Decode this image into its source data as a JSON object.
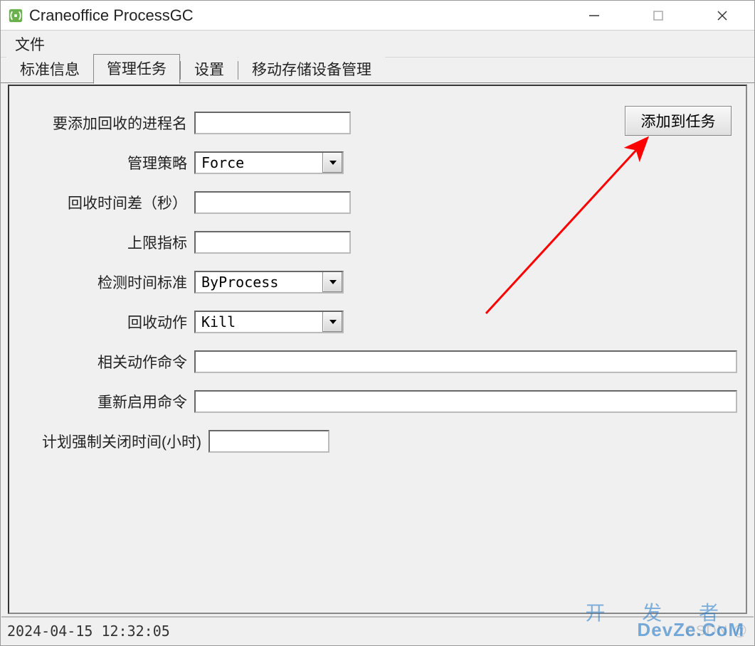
{
  "window": {
    "title": "Craneoffice ProcessGC"
  },
  "menubar": {
    "file": "文件"
  },
  "tabs": {
    "standard_info": "标准信息",
    "manage_tasks": "管理任务",
    "settings": "设置",
    "mobile_storage": "移动存储设备管理",
    "active_index": 1
  },
  "form": {
    "proc_name_label": "要添加回收的进程名",
    "proc_name_value": "",
    "strategy_label": "管理策略",
    "strategy_value": "Force",
    "interval_label": "回收时间差（秒）",
    "interval_value": "",
    "upper_limit_label": "上限指标",
    "upper_limit_value": "",
    "detect_std_label": "检测时间标准",
    "detect_std_value": "ByProcess",
    "action_label": "回收动作",
    "action_value": "Kill",
    "related_cmd_label": "相关动作命令",
    "related_cmd_value": "",
    "reenable_cmd_label": "重新启用命令",
    "reenable_cmd_value": "",
    "force_close_label": "计划强制关闭时间(小时)",
    "force_close_value": "",
    "add_button": "添加到任务"
  },
  "statusbar": {
    "datetime": "2024-04-15 12:32:05",
    "csdn_watermark": "CSDN @"
  },
  "watermark": {
    "line1": "开 发 者",
    "line2": "DevZe.CoM"
  },
  "colors": {
    "panel_bg": "#f0f0f0",
    "border": "#888888",
    "arrow": "#ff0000"
  }
}
